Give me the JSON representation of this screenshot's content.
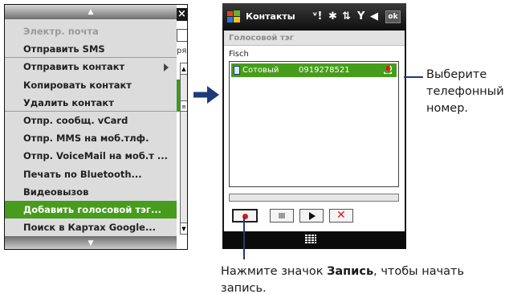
{
  "left_screen": {
    "background_window": {
      "close_label": "×",
      "field_text": "ря"
    },
    "menu": {
      "scroll_up": "▲",
      "scroll_down": "▼",
      "items": [
        {
          "label": "Электр. почта",
          "disabled": true
        },
        {
          "label": "Отправить SMS",
          "separator_after": true
        },
        {
          "label": "Отправить контакт",
          "has_submenu": true
        },
        {
          "label": "Копировать контакт"
        },
        {
          "label": "Удалить контакт",
          "separator_after": true
        },
        {
          "label": "Отпр. сообщ. vCard"
        },
        {
          "label": "Отпр. MMS на моб.тлф."
        },
        {
          "label": "Отпр. VoiceMail на моб.т ..."
        },
        {
          "label": "Печать по Bluetooth..."
        },
        {
          "label": "Видеовызов"
        },
        {
          "label": "Добавить голосовой тэг...",
          "selected": true
        },
        {
          "label": "Поиск в Картах Google..."
        }
      ]
    }
  },
  "right_screen": {
    "title": "Контакты",
    "status_icons": [
      "signal-call-icon",
      "bluetooth-icon",
      "data-connection-icon",
      "signal-strength-icon",
      "volume-icon"
    ],
    "status_glyphs": {
      "call": "ᵛ!",
      "bluetooth": "✱",
      "connection": "⇅",
      "signal": "Y",
      "volume": "◀"
    },
    "ok_label": "ok",
    "subtitle": "Голосовой тэг",
    "contact_name": "Fisch",
    "phone_rows": [
      {
        "type": "Сотовый",
        "number": "0919278521",
        "selected": true
      }
    ],
    "controls": [
      "record",
      "stop",
      "play",
      "delete"
    ]
  },
  "callouts": {
    "select_number": [
      "Выберите",
      "телефонный",
      "номер."
    ],
    "record_prefix": "Нажмите значок ",
    "record_bold": "Запись",
    "record_suffix": ", чтобы начать запись."
  },
  "colors": {
    "highlight_green": "#479c1c",
    "arrow_blue": "#1f3a78",
    "record_red": "#e3170f"
  }
}
